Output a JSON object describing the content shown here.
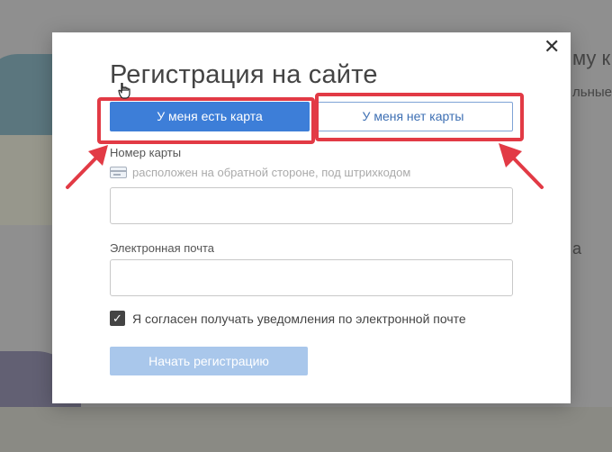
{
  "background": {
    "heading_fragment": "му к",
    "text_fragment": "льные",
    "text_fragment2": "а"
  },
  "modal": {
    "title": "Регистрация на сайте",
    "close_glyph": "✕",
    "tabs": [
      {
        "label": "У меня есть карта",
        "active": true
      },
      {
        "label": "У меня нет карты",
        "active": false
      }
    ],
    "card_number": {
      "label": "Номер карты",
      "hint": "расположен на обратной стороне, под штрихкодом",
      "value": ""
    },
    "email": {
      "label": "Электронная почта",
      "value": ""
    },
    "consent": {
      "checked": true,
      "check_glyph": "✓",
      "label": "Я согласен получать уведомления по электронной почте"
    },
    "submit_label": "Начать регистрацию"
  },
  "annotation": {
    "highlight_color": "#e23a45"
  },
  "colors": {
    "primary": "#3d7ed8",
    "disabled_button": "#a9c7eb"
  }
}
